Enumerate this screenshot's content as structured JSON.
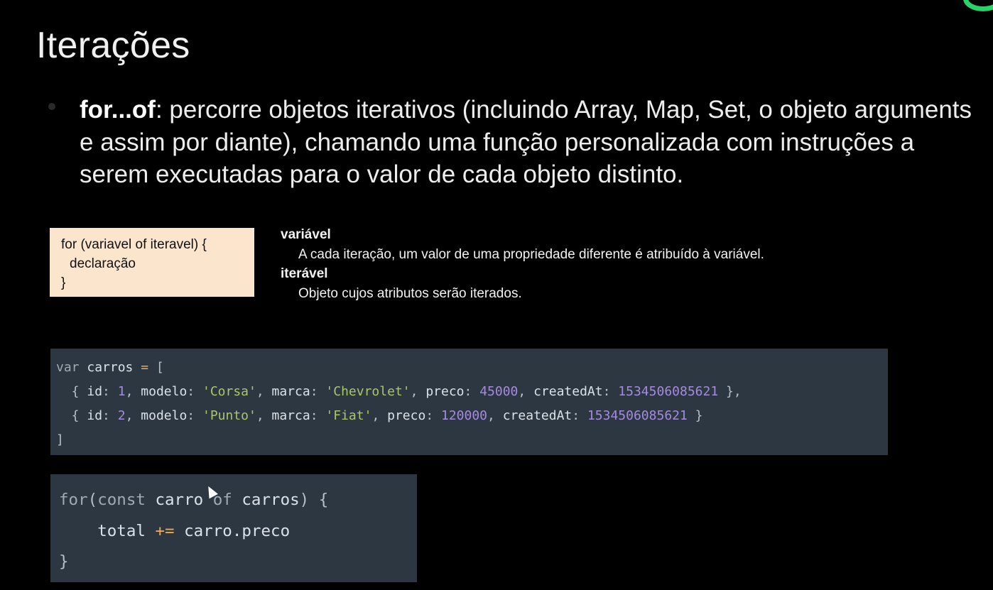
{
  "slide": {
    "title": "Iterações",
    "bullet": {
      "term": "for...of",
      "text": ": percorre objetos iterativos (incluindo Array, Map, Set, o objeto arguments e assim por diante), chamando uma função personalizada com instruções a serem executadas para o valor de cada objeto distinto."
    }
  },
  "syntax": {
    "line1": "for (variavel of iteravel) {",
    "line2": "declaração",
    "line3": "}"
  },
  "definitions": {
    "var_term": "variável",
    "var_desc": "A cada iteração, um valor de uma propriedade diferente é atribuído à variável.",
    "iter_term": "iterável",
    "iter_desc": "Objeto cujos atributos serão iterados."
  },
  "code_array": {
    "kw_var": "var",
    "ident_carros": "carros",
    "op_assign": "=",
    "open_bracket": "[",
    "close_bracket": "]",
    "rows": [
      {
        "id": "1",
        "modelo": "'Corsa'",
        "marca": "'Chevrolet'",
        "preco": "45000",
        "createdAt": "1534506085621",
        "tail": " },"
      },
      {
        "id": "2",
        "modelo": "'Punto'",
        "marca": "'Fiat'",
        "preco": "120000",
        "createdAt": "1534506085621",
        "tail": " }"
      }
    ],
    "keys": {
      "id": "id",
      "modelo": "modelo",
      "marca": "marca",
      "preco": "preco",
      "createdAt": "createdAt"
    }
  },
  "code_loop": {
    "kw_for": "for",
    "open_paren": "(",
    "kw_const": "const",
    "ident_carro": "carro",
    "kw_of": "of",
    "ident_carros": "carros",
    "close_paren_brace": ") {",
    "ident_total": "total",
    "op_plus_assign": "+=",
    "expr_preco": "carro.preco",
    "close_brace": "}"
  },
  "colors": {
    "background": "#000000",
    "code_background": "#2c3742",
    "syntax_box_background": "#fbe5cd",
    "string": "#a8c76a",
    "number": "#a58ae0",
    "operator": "#f0a84a",
    "accent": "#27d46b"
  },
  "icons": {
    "pointer": "mouse-cursor-icon",
    "accent": "circle-accent-icon"
  }
}
